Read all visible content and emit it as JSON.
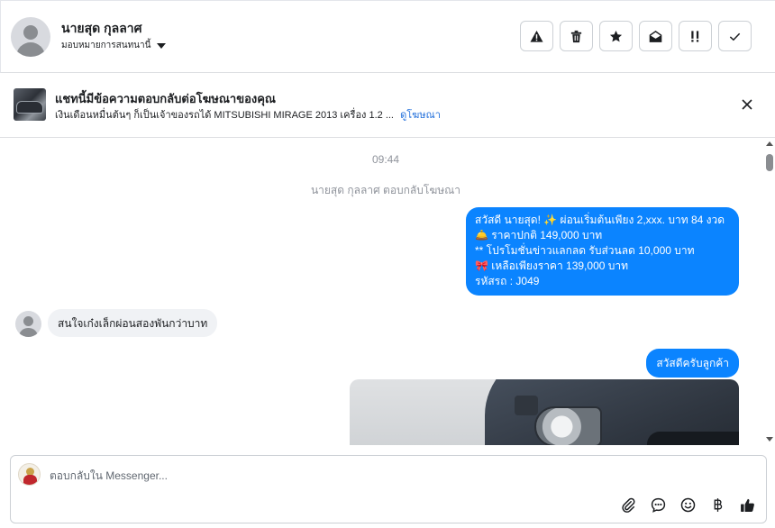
{
  "header": {
    "contact_name": "นายสุด กุลลาศ",
    "assign_label": "มอบหมายการสนทนานี้",
    "actions": [
      {
        "name": "report-spam",
        "icon": "warning-icon"
      },
      {
        "name": "delete",
        "icon": "trash-icon"
      },
      {
        "name": "star",
        "icon": "star-icon"
      },
      {
        "name": "mark-unread",
        "icon": "envelope-open-icon"
      },
      {
        "name": "follow-up",
        "icon": "double-exclamation-icon"
      },
      {
        "name": "mark-done",
        "icon": "check-icon"
      }
    ]
  },
  "ad_banner": {
    "title": "แชทนี้มีข้อความตอบกลับต่อโฆษณาของคุณ",
    "description": "เงินเดือนหมื่นต้นๆ ก็เป็นเจ้าของรถได้ MITSUBISHI MIRAGE 2013 เครื่อง 1.2 ...",
    "link_label": "ดูโฆษณา"
  },
  "conversation": {
    "time": "09:44",
    "system_note": "นายสุด กุลลาศ ตอบกลับโฆษณา",
    "outgoing_1": {
      "lines": [
        "สวัสดี นายสุด! ✨  ผ่อนเริ่มต้นเพียง 2,xxx. บาท 84 งวด",
        "🛎️ ราคาปกติ 149,000 บาท",
        "** โปรโมชั่นข่าวแลกลด รับส่วนลด 10,000 บาท",
        "🎀  เหลือเพียงราคา 139,000 บาท",
        " รหัสรถ : J049"
      ]
    },
    "incoming_1": "สนใจเก๋งเล็กผ่อนสองพันกว่าบาท",
    "outgoing_2": "สวัสดีครับลูกค้า"
  },
  "composer": {
    "placeholder": "ตอบกลับใน Messenger...",
    "tools": [
      "paperclip-icon",
      "chat-bubble-icon",
      "smiley-icon",
      "baht-icon",
      "thumbs-up-icon"
    ]
  },
  "colors": {
    "outgoing_bubble": "#0b84ff",
    "incoming_bubble": "#f0f2f5",
    "link": "#216fdb"
  }
}
